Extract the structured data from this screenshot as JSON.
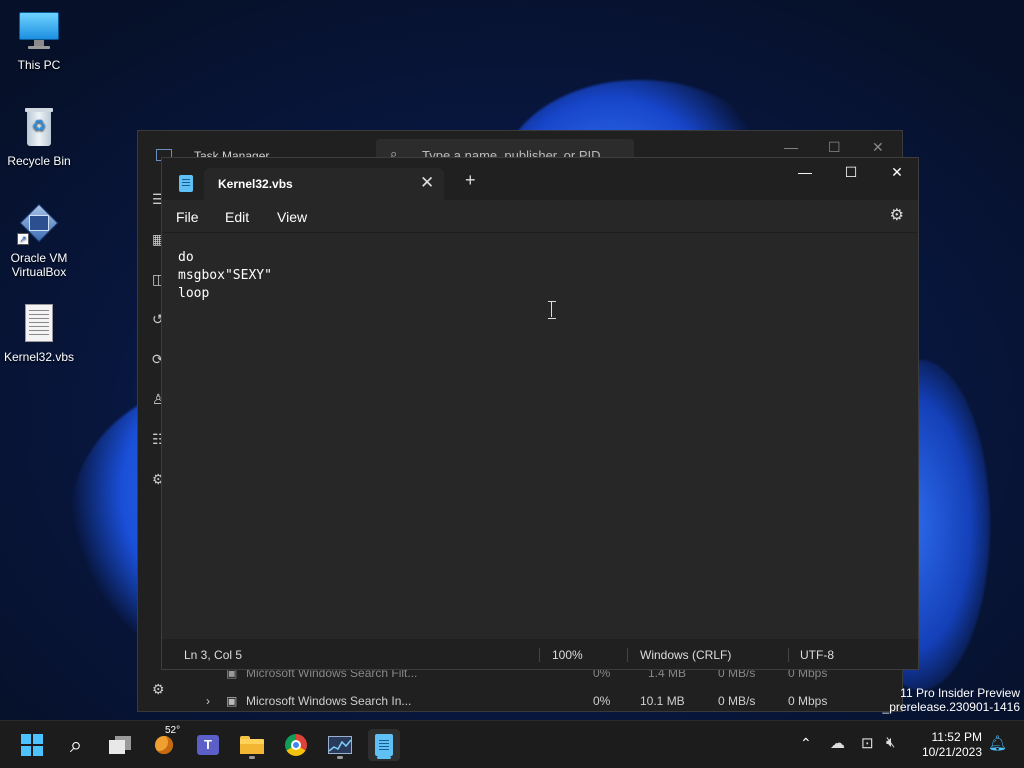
{
  "desktop": {
    "icons": [
      {
        "label": "This PC"
      },
      {
        "label": "Recycle Bin"
      },
      {
        "label_line1": "Oracle VM",
        "label_line2": "VirtualBox"
      },
      {
        "label": "Kernel32.vbs"
      }
    ],
    "watermark": {
      "line1": "11 Pro Insider Preview",
      "line2": "_prerelease.230901-1416"
    }
  },
  "task_manager": {
    "title": "Task Manager",
    "search_placeholder": "Type a name, publisher, or PID",
    "rows": [
      {
        "name": "Microsoft Windows Search Filt...",
        "cpu": "0%",
        "memory": "1.4 MB",
        "disk": "0 MB/s",
        "network": "0 Mbps"
      },
      {
        "name": "Microsoft Windows Search In...",
        "cpu": "0%",
        "memory": "10.1 MB",
        "disk": "0 MB/s",
        "network": "0 Mbps"
      }
    ]
  },
  "notepad": {
    "tab_title": "Kernel32.vbs",
    "menu": {
      "file": "File",
      "edit": "Edit",
      "view": "View"
    },
    "content": "do\nmsgbox\"SEXY\"\nloop",
    "status": {
      "position": "Ln 3, Col 5",
      "zoom": "100%",
      "line_ending": "Windows (CRLF)",
      "encoding": "UTF-8"
    }
  },
  "taskbar": {
    "weather_temp": "52°",
    "time": "11:52 PM",
    "date": "10/21/2023"
  },
  "colors": {
    "accent": "#5fc0f5",
    "window_bg": "#272727",
    "titlebar_bg": "#202020",
    "taskbar_bg": "#1c1c1c"
  }
}
